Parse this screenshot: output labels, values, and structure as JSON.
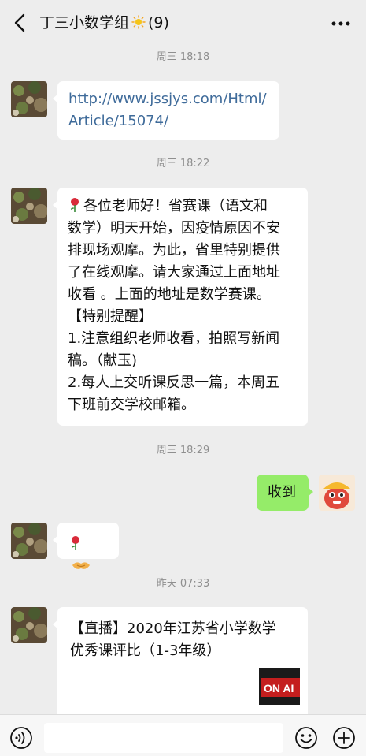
{
  "header": {
    "title": "丁三小数学组",
    "count": "(9)",
    "back_icon": "chevron-left-icon",
    "more_icon": "more-dots-icon",
    "title_emoji": "sun-icon"
  },
  "messages": [
    {
      "timestamp": "周三 18:18",
      "link_lines": [
        "http://www.jssjys.com/Html/",
        "Article/15074/"
      ]
    },
    {
      "timestamp": "周三 18:22",
      "lines": [
        "各位老师好！省赛课（语文和",
        "数学）明天开始，因疫情原因不安",
        "排现场观摩。为此，省里特别提供",
        "了在线观摩。请大家通过上面地址",
        "收看 。上面的地址是数学赛课。",
        "【特别提醒】",
        "1.注意组织老师收看，拍照写新闻",
        "稿。（献玉)",
        "2.每人上交听课反思一篇，本周五",
        "下班前交学校邮箱。"
      ],
      "lead_emoji": "rose-icon"
    },
    {
      "timestamp": "周三 18:29",
      "self_text": "收到"
    },
    {
      "emojis": [
        "rose-icon",
        "handshake-icon"
      ]
    },
    {
      "timestamp": "昨天 07:33",
      "card_lines": [
        "【直播】2020年江苏省小学数学",
        "优秀课评比（1-3年级）"
      ],
      "thumb_text": "ON AI"
    }
  ],
  "input_bar": {
    "voice_icon": "voice-icon",
    "emoji_icon": "emoji-icon",
    "plus_icon": "plus-circle-icon"
  },
  "colors": {
    "background": "#ededed",
    "self_bubble": "#95ec69",
    "link": "#3f6b9a",
    "timestamp": "#8f8f8f"
  }
}
